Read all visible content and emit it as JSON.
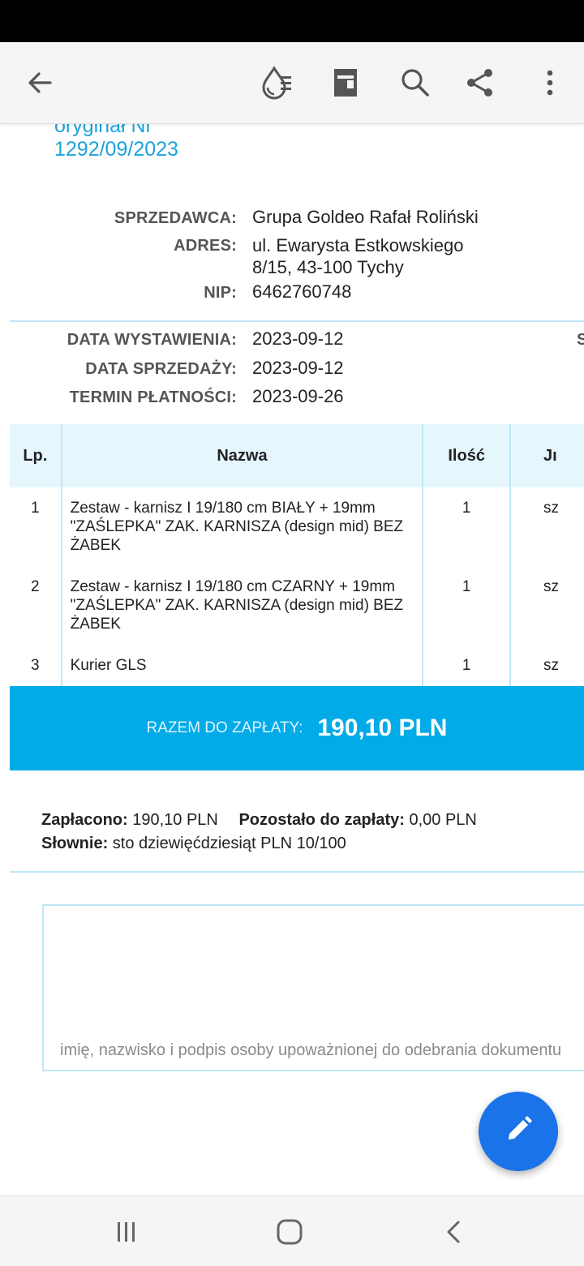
{
  "toolbar": {
    "icons": [
      "back-arrow-icon",
      "watermark-icon",
      "layout-icon",
      "search-icon",
      "share-icon",
      "more-vert-icon"
    ]
  },
  "document": {
    "number_prefix": "oryginał Nr",
    "number": "1292/09/2023",
    "seller": {
      "seller_label": "SPRZEDAWCA:",
      "seller_value": "Grupa Goldeo Rafał Roliński",
      "address_label": "ADRES:",
      "address_line1": "ul. Ewarysta Estkowskiego",
      "address_line2": "8/15, 43-100 Tychy",
      "nip_label": "NIP:",
      "nip_value": "6462760748"
    },
    "dates": {
      "issue_label": "DATA WYSTAWIENIA:",
      "issue_value": "2023-09-12",
      "sale_label": "DATA SPRZEDAŻY:",
      "sale_value": "2023-09-12",
      "due_label": "TERMIN PŁATNOŚCI:",
      "due_value": "2023-09-26",
      "clipped_right_char": "S"
    },
    "table": {
      "headers": [
        "Lp.",
        "Nazwa",
        "Ilość",
        "Jı"
      ],
      "rows": [
        {
          "lp": "1",
          "name": "Zestaw - karnisz I 19/180 cm BIAŁY + 19mm \"ZAŚLEPKA\" ZAK. KARNISZA (design mid) BEZ ŻABEK",
          "qty": "1",
          "unit": "sz"
        },
        {
          "lp": "2",
          "name": "Zestaw - karnisz I 19/180 cm CZARNY + 19mm \"ZAŚLEPKA\" ZAK. KARNISZA (design mid) BEZ ŻABEK",
          "qty": "1",
          "unit": "sz"
        },
        {
          "lp": "3",
          "name": "Kurier GLS",
          "qty": "1",
          "unit": "sz"
        }
      ]
    },
    "total": {
      "label": "RAZEM DO ZAPŁATY:",
      "value": "190,10 PLN"
    },
    "summary": {
      "paid_label": "Zapłacono:",
      "paid_value": "190,10 PLN",
      "remaining_label": "Pozostało do zapłaty:",
      "remaining_value": "0,00 PLN",
      "words_label": "Słownie:",
      "words_value": "sto dziewięćdziesiąt PLN 10/100"
    },
    "signature_caption": "imię, nazwisko i podpis osoby upoważnionej do odebrania dokumentu"
  },
  "colors": {
    "accent": "#00abe8",
    "doc_number": "#1ba3dc",
    "table_header_bg": "#e6f6fd",
    "border": "#bfe7f4",
    "fab": "#1a73e8"
  }
}
